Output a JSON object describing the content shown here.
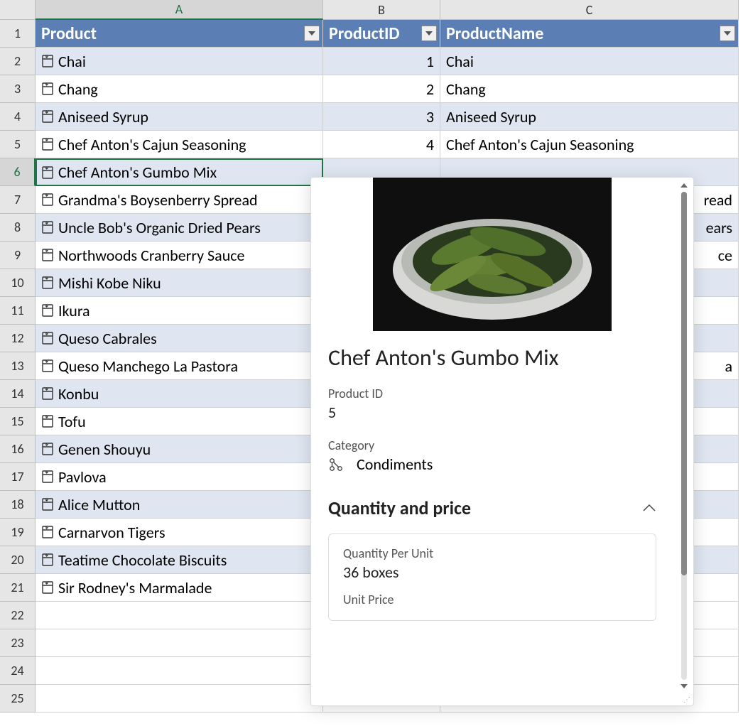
{
  "columns": {
    "A": "A",
    "B": "B",
    "C": "C"
  },
  "headers": {
    "product": "Product",
    "productId": "ProductID",
    "productName": "ProductName"
  },
  "selectedRow": 6,
  "rows": [
    {
      "n": 1,
      "product": "",
      "id": "",
      "name": "",
      "isHeader": true
    },
    {
      "n": 2,
      "product": "Chai",
      "id": "1",
      "name": "Chai"
    },
    {
      "n": 3,
      "product": "Chang",
      "id": "2",
      "name": "Chang"
    },
    {
      "n": 4,
      "product": "Aniseed Syrup",
      "id": "3",
      "name": "Aniseed Syrup"
    },
    {
      "n": 5,
      "product": "Chef Anton's Cajun Seasoning",
      "id": "4",
      "name": "Chef Anton's Cajun Seasoning"
    },
    {
      "n": 6,
      "product": "Chef Anton's Gumbo Mix",
      "id": "",
      "name": ""
    },
    {
      "n": 7,
      "product": "Grandma's Boysenberry Spread",
      "id": "",
      "name": "read"
    },
    {
      "n": 8,
      "product": "Uncle Bob's Organic Dried Pears",
      "id": "",
      "name": "ears"
    },
    {
      "n": 9,
      "product": "Northwoods Cranberry Sauce",
      "id": "",
      "name": "ce"
    },
    {
      "n": 10,
      "product": "Mishi Kobe Niku",
      "id": "",
      "name": ""
    },
    {
      "n": 11,
      "product": "Ikura",
      "id": "",
      "name": ""
    },
    {
      "n": 12,
      "product": "Queso Cabrales",
      "id": "",
      "name": ""
    },
    {
      "n": 13,
      "product": "Queso Manchego La Pastora",
      "id": "",
      "name": "a"
    },
    {
      "n": 14,
      "product": "Konbu",
      "id": "",
      "name": ""
    },
    {
      "n": 15,
      "product": "Tofu",
      "id": "",
      "name": ""
    },
    {
      "n": 16,
      "product": "Genen Shouyu",
      "id": "",
      "name": ""
    },
    {
      "n": 17,
      "product": "Pavlova",
      "id": "",
      "name": ""
    },
    {
      "n": 18,
      "product": "Alice Mutton",
      "id": "",
      "name": ""
    },
    {
      "n": 19,
      "product": "Carnarvon Tigers",
      "id": "",
      "name": ""
    },
    {
      "n": 20,
      "product": "Teatime Chocolate Biscuits",
      "id": "",
      "name": ""
    },
    {
      "n": 21,
      "product": "Sir Rodney's Marmalade",
      "id": "",
      "name": ""
    },
    {
      "n": 22,
      "product": "",
      "id": "",
      "name": "",
      "empty": true
    },
    {
      "n": 23,
      "product": "",
      "id": "",
      "name": "",
      "empty": true
    },
    {
      "n": 24,
      "product": "",
      "id": "",
      "name": "",
      "empty": true
    },
    {
      "n": 25,
      "product": "",
      "id": "",
      "name": "",
      "empty": true
    }
  ],
  "card": {
    "title": "Chef Anton's Gumbo Mix",
    "productIdLabel": "Product ID",
    "productIdValue": "5",
    "categoryLabel": "Category",
    "categoryValue": "Condiments",
    "sectionTitle": "Quantity and price",
    "qpuLabel": "Quantity Per Unit",
    "qpuValue": "36 boxes",
    "unitPriceLabel": "Unit Price"
  }
}
